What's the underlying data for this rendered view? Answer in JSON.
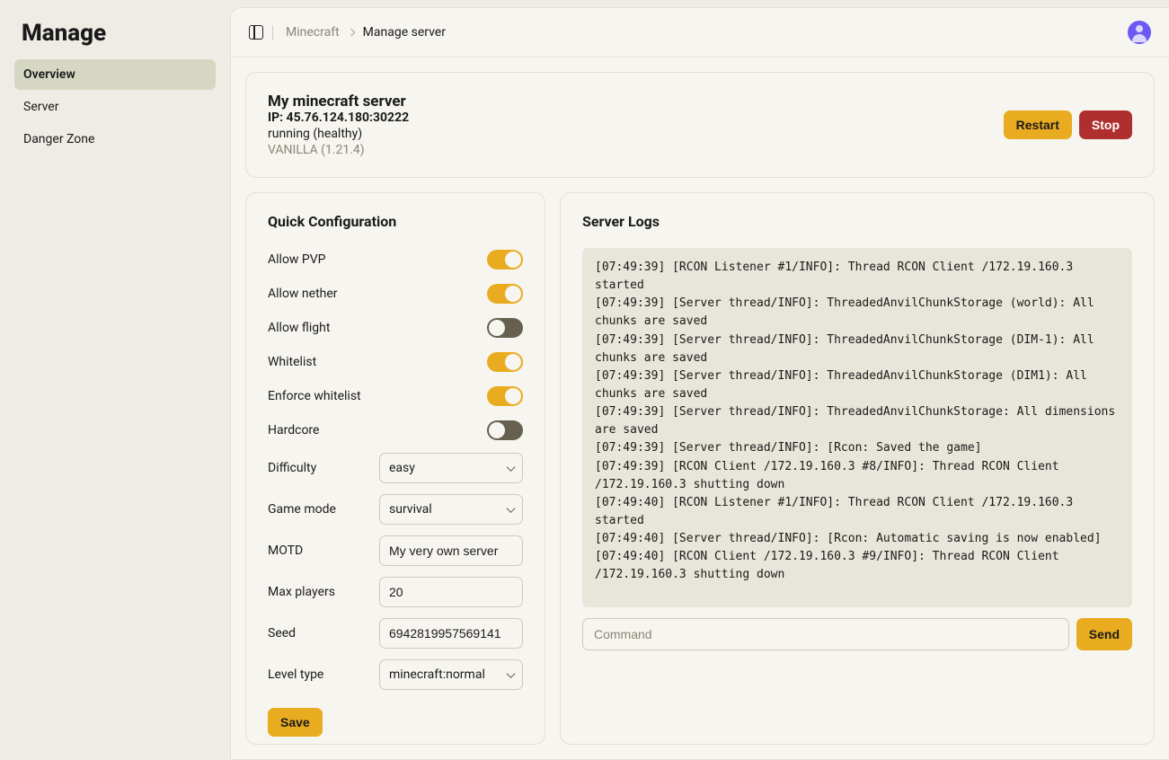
{
  "app": {
    "title": "Manage"
  },
  "sidebar": {
    "items": [
      {
        "label": "Overview"
      },
      {
        "label": "Server"
      },
      {
        "label": "Danger Zone"
      }
    ]
  },
  "breadcrumb": {
    "root": "Minecraft",
    "leaf": "Manage server"
  },
  "status": {
    "name": "My minecraft server",
    "ip_label": "IP: 45.76.124.180:30222",
    "running": "running (healthy)",
    "version": "VANILLA (1.21.4)",
    "restart_label": "Restart",
    "stop_label": "Stop"
  },
  "config": {
    "section_title": "Quick Configuration",
    "toggles": {
      "allow_pvp_label": "Allow PVP",
      "allow_pvp_on": true,
      "allow_nether_label": "Allow nether",
      "allow_nether_on": true,
      "allow_flight_label": "Allow flight",
      "allow_flight_on": false,
      "whitelist_label": "Whitelist",
      "whitelist_on": true,
      "enforce_whitelist_label": "Enforce whitelist",
      "enforce_whitelist_on": true,
      "hardcore_label": "Hardcore",
      "hardcore_on": false
    },
    "fields": {
      "difficulty_label": "Difficulty",
      "difficulty_value": "easy",
      "gamemode_label": "Game mode",
      "gamemode_value": "survival",
      "motd_label": "MOTD",
      "motd_value": "My very own server",
      "max_players_label": "Max players",
      "max_players_value": "20",
      "seed_label": "Seed",
      "seed_value": "6942819957569141",
      "level_type_label": "Level type",
      "level_type_value": "minecraft:normal"
    },
    "save_label": "Save"
  },
  "logs": {
    "section_title": "Server Logs",
    "lines": [
      "[07:49:39] [RCON Listener #1/INFO]: Thread RCON Client /172.19.160.3 started",
      "[07:49:39] [Server thread/INFO]: ThreadedAnvilChunkStorage (world): All chunks are saved",
      "[07:49:39] [Server thread/INFO]: ThreadedAnvilChunkStorage (DIM-1): All chunks are saved",
      "[07:49:39] [Server thread/INFO]: ThreadedAnvilChunkStorage (DIM1): All chunks are saved",
      "[07:49:39] [Server thread/INFO]: ThreadedAnvilChunkStorage: All dimensions are saved",
      "[07:49:39] [Server thread/INFO]: [Rcon: Saved the game]",
      "[07:49:39] [RCON Client /172.19.160.3 #8/INFO]: Thread RCON Client /172.19.160.3 shutting down",
      "[07:49:40] [RCON Listener #1/INFO]: Thread RCON Client /172.19.160.3 started",
      "[07:49:40] [Server thread/INFO]: [Rcon: Automatic saving is now enabled]",
      "[07:49:40] [RCON Client /172.19.160.3 #9/INFO]: Thread RCON Client /172.19.160.3 shutting down"
    ],
    "command_placeholder": "Command",
    "send_label": "Send"
  }
}
